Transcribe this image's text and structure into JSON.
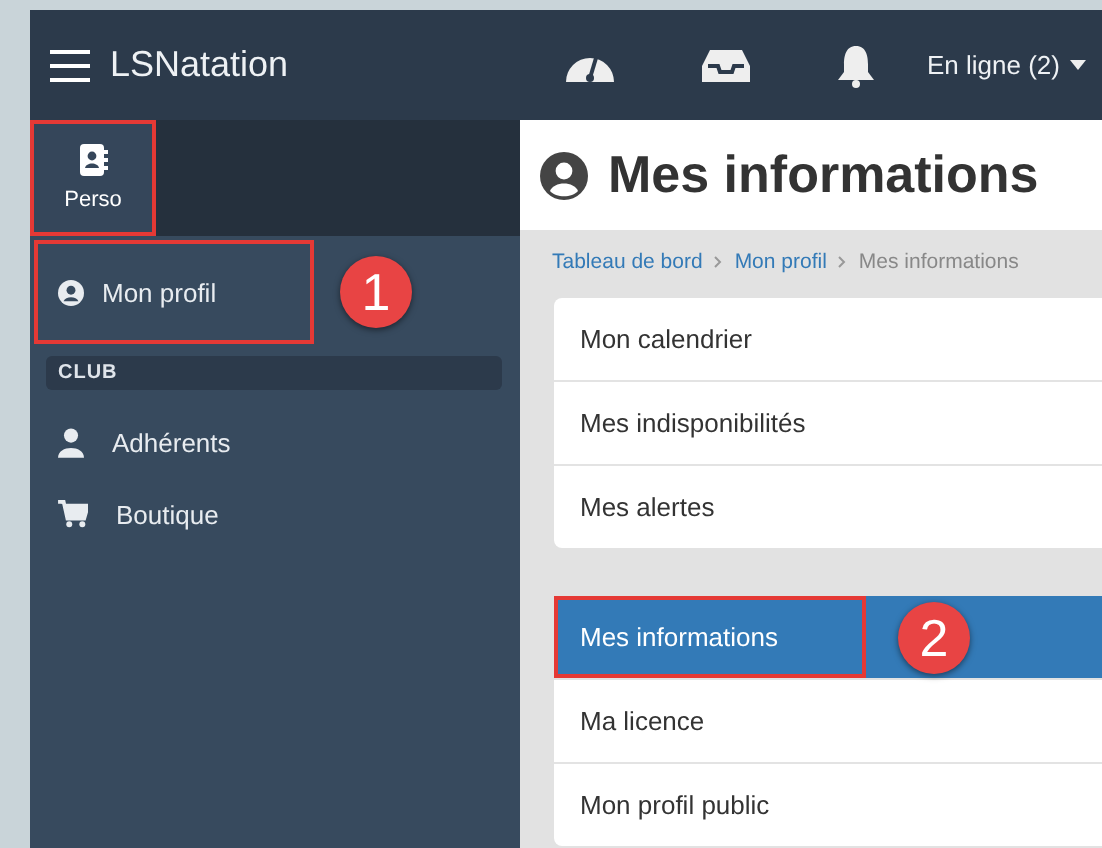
{
  "topbar": {
    "brand": "LSNatation",
    "status": "En ligne (2)"
  },
  "sidebar": {
    "tabs": [
      {
        "label": "Perso",
        "selected": true,
        "highlighted": true
      }
    ],
    "items": [
      {
        "kind": "link",
        "label": "Mon profil",
        "highlighted": true,
        "callout": "1"
      },
      {
        "kind": "header",
        "label": "CLUB"
      },
      {
        "kind": "link",
        "label": "Adhérents",
        "highlighted": false
      },
      {
        "kind": "link",
        "label": "Boutique",
        "highlighted": false
      }
    ]
  },
  "page": {
    "title": "Mes informations",
    "breadcrumb": [
      {
        "label": "Tableau de bord",
        "link": true
      },
      {
        "label": "Mon profil",
        "link": true
      },
      {
        "label": "Mes informations",
        "link": false
      }
    ],
    "groups": [
      {
        "items": [
          {
            "label": "Mon calendrier",
            "selected": false
          },
          {
            "label": "Mes indisponibilités",
            "selected": false
          },
          {
            "label": "Mes alertes",
            "selected": false
          }
        ]
      },
      {
        "items": [
          {
            "label": "Mes informations",
            "selected": true,
            "highlighted": true,
            "callout": "2"
          },
          {
            "label": "Ma licence",
            "selected": false
          },
          {
            "label": "Mon profil public",
            "selected": false
          }
        ]
      }
    ]
  }
}
